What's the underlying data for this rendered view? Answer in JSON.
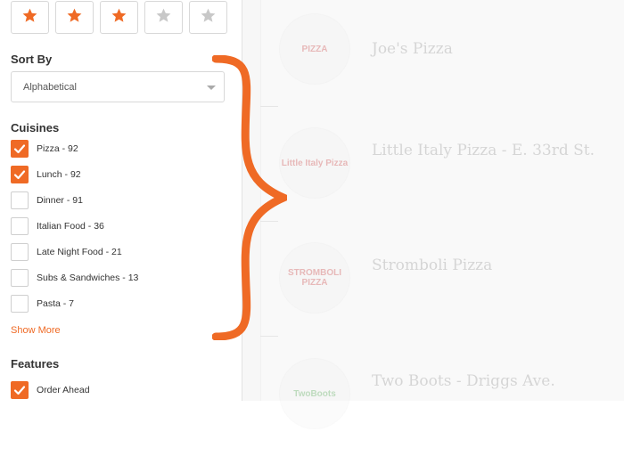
{
  "rating": {
    "stars": [
      {
        "filled": true
      },
      {
        "filled": true
      },
      {
        "filled": true
      },
      {
        "filled": false
      },
      {
        "filled": false
      }
    ],
    "filled_color": "#ef6a25",
    "empty_color": "#c8c8c8"
  },
  "sort": {
    "title": "Sort By",
    "selected": "Alphabetical"
  },
  "cuisines": {
    "title": "Cuisines",
    "items": [
      {
        "label": "Pizza - 92",
        "checked": true
      },
      {
        "label": "Lunch - 92",
        "checked": true
      },
      {
        "label": "Dinner - 91",
        "checked": false
      },
      {
        "label": "Italian Food - 36",
        "checked": false
      },
      {
        "label": "Late Night Food - 21",
        "checked": false
      },
      {
        "label": "Subs & Sandwiches - 13",
        "checked": false
      },
      {
        "label": "Pasta - 7",
        "checked": false
      }
    ],
    "show_more": "Show More"
  },
  "features": {
    "title": "Features",
    "items": [
      {
        "label": "Order Ahead",
        "checked": true
      }
    ]
  },
  "results": [
    {
      "name": "Joe's Pizza",
      "logo_text": "PIZZA"
    },
    {
      "name": "Little Italy Pizza - E. 33rd St.",
      "logo_text": "Little Italy Pizza"
    },
    {
      "name": "Stromboli Pizza",
      "logo_text": "STROMBOLI PIZZA"
    },
    {
      "name": "Two Boots - Driggs Ave.",
      "logo_text": "TwoBoots"
    }
  ],
  "colors": {
    "accent": "#ef6a25"
  }
}
